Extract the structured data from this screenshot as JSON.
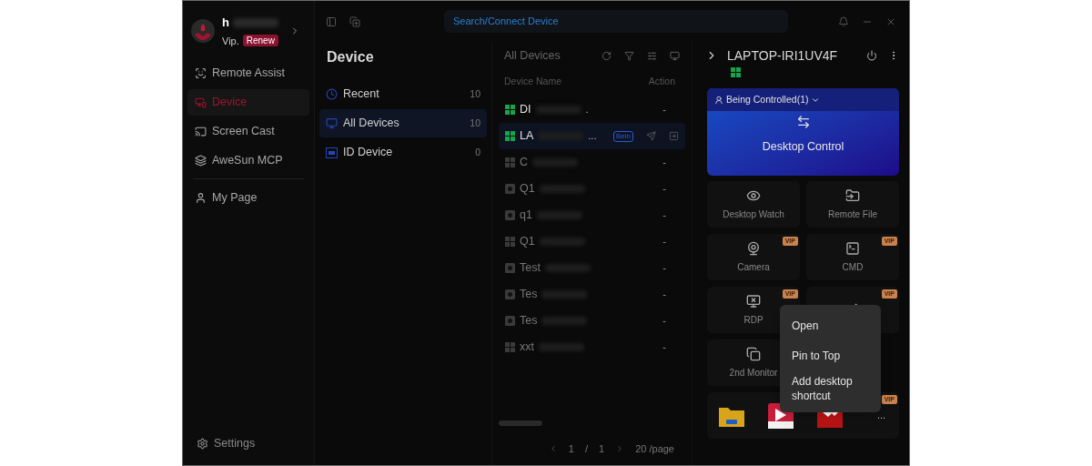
{
  "account": {
    "name": "h",
    "level": "Vip.",
    "badge": "Renew"
  },
  "sidebar": {
    "items": [
      {
        "label": "Remote Assist",
        "selected": false
      },
      {
        "label": "Device",
        "selected": true
      },
      {
        "label": "Screen Cast",
        "selected": false
      },
      {
        "label": "AweSun MCP",
        "selected": false
      },
      {
        "label": "My Page",
        "selected": false
      }
    ],
    "settings": "Settings"
  },
  "search": {
    "placeholder": "Search/Connect Device"
  },
  "groups": {
    "title": "Device",
    "items": [
      {
        "label": "Recent",
        "count": "10",
        "selected": false
      },
      {
        "label": "All Devices",
        "count": "10",
        "selected": true
      },
      {
        "label": "ID Device",
        "count": "0",
        "selected": false
      }
    ]
  },
  "device_list": {
    "title": "All Devices",
    "columns": [
      "Device Name",
      "Action"
    ],
    "rows": [
      {
        "name": "DI",
        "suffix": ".",
        "kind": "windows",
        "online": true,
        "selected": false,
        "action": "-"
      },
      {
        "name": "LA",
        "suffix": "...",
        "kind": "windows",
        "online": true,
        "selected": true,
        "badge": "Bein"
      },
      {
        "name": "C",
        "kind": "windows",
        "online": false,
        "selected": false,
        "action": "-"
      },
      {
        "name": "Q1",
        "kind": "camera",
        "online": false,
        "selected": false,
        "action": "-"
      },
      {
        "name": "q1",
        "kind": "camera",
        "online": false,
        "selected": false,
        "action": "-"
      },
      {
        "name": "Q1",
        "kind": "windows",
        "online": false,
        "selected": false,
        "action": "-"
      },
      {
        "name": "Test",
        "kind": "camera",
        "online": false,
        "selected": false,
        "action": "-"
      },
      {
        "name": "Tes",
        "kind": "camera",
        "online": false,
        "selected": false,
        "action": "-"
      },
      {
        "name": "Tes",
        "kind": "camera",
        "online": false,
        "selected": false,
        "action": "-"
      },
      {
        "name": "xxt",
        "kind": "windows",
        "online": false,
        "selected": false,
        "action": "-"
      }
    ],
    "pagination": {
      "page": "1",
      "separator": "/",
      "total": "1",
      "page_size": "20 /page"
    }
  },
  "detail": {
    "device": "LAPTOP-IRI1UV4F",
    "online": true,
    "control": {
      "status": "Being Controlled(1)",
      "action": "Desktop Control"
    },
    "tiles": [
      {
        "label": "Desktop Watch",
        "kind": "eye"
      },
      {
        "label": "Remote File",
        "kind": "folder"
      },
      {
        "label": "Camera",
        "kind": "camera",
        "badge": "VIP"
      },
      {
        "label": "CMD",
        "kind": "cmd",
        "badge": "VIP"
      },
      {
        "label": "RDP",
        "kind": "rdp",
        "badge": "VIP"
      },
      {
        "kind": "switch",
        "badge": "VIP"
      },
      {
        "label": "2nd Monitor",
        "kind": "monitors"
      }
    ],
    "shortcuts": {
      "badge": "VIP",
      "more": "...",
      "apps": [
        {
          "kind": "files"
        },
        {
          "kind": "video"
        },
        {
          "kind": "remote"
        }
      ]
    }
  },
  "context_menu": {
    "items": [
      "Open",
      "Pin to Top",
      "Add desktop shortcut"
    ]
  }
}
